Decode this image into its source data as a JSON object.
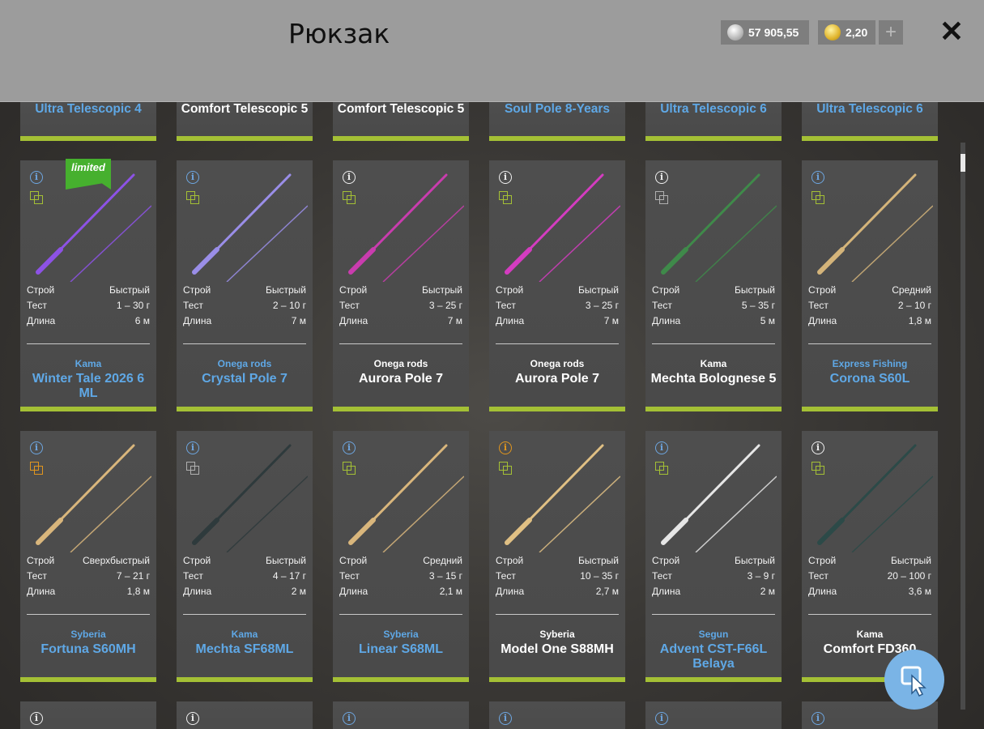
{
  "header": {
    "title": "Рюкзак",
    "silver_amount": "57 905,55",
    "gold_amount": "2,20",
    "plus_label": "+",
    "close_label": "✕"
  },
  "top_row": [
    {
      "name": "Ultra Telescopic 4",
      "color": "blue"
    },
    {
      "name": "Comfort Telescopic 5",
      "color": "white"
    },
    {
      "name": "Comfort Telescopic 5",
      "color": "white"
    },
    {
      "name": "Soul Pole 8-Years",
      "color": "blue"
    },
    {
      "name": "Ultra Telescopic 6",
      "color": "blue"
    },
    {
      "name": "Ultra Telescopic 6",
      "color": "blue"
    }
  ],
  "labels": {
    "action": "Строй",
    "test": "Тест",
    "length": "Длина"
  },
  "badge": {
    "limited": "limited"
  },
  "row1": [
    {
      "action": "Быстрый",
      "test": "1 – 30 г",
      "length": "6 м",
      "brand": "Kama",
      "model": "Winter Tale 2026 6 ML",
      "color": "blue",
      "info": "blue",
      "copy": "green",
      "limited": true,
      "rod_color": "#8d52e6"
    },
    {
      "action": "Быстрый",
      "test": "2 – 10 г",
      "length": "7 м",
      "brand": "Onega rods",
      "model": "Crystal Pole 7",
      "color": "blue",
      "info": "blue",
      "copy": "green",
      "limited": false,
      "rod_color": "#9a8ee8"
    },
    {
      "action": "Быстрый",
      "test": "3 – 25 г",
      "length": "7 м",
      "brand": "Onega rods",
      "model": "Aurora Pole 7",
      "color": "white",
      "info": "white",
      "copy": "green",
      "limited": false,
      "rod_color": "#c93cae"
    },
    {
      "action": "Быстрый",
      "test": "3 – 25 г",
      "length": "7 м",
      "brand": "Onega rods",
      "model": "Aurora Pole 7",
      "color": "white",
      "info": "white",
      "copy": "green",
      "limited": false,
      "rod_color": "#d43cc0"
    },
    {
      "action": "Быстрый",
      "test": "5 – 35 г",
      "length": "5 м",
      "brand": "Kama",
      "model": "Mechta Bolognese 5",
      "color": "white",
      "info": "white",
      "copy": "grey",
      "limited": false,
      "rod_color": "#3f8a4a"
    },
    {
      "action": "Средний",
      "test": "2 – 10 г",
      "length": "1,8 м",
      "brand": "Express Fishing",
      "model": "Corona S60L",
      "color": "blue",
      "info": "blue",
      "copy": "green",
      "limited": false,
      "rod_color": "#d4b47a"
    }
  ],
  "row2": [
    {
      "action": "Сверхбыстрый",
      "test": "7 – 21 г",
      "length": "1,8 м",
      "brand": "Syberia",
      "model": "Fortuna S60MH",
      "color": "blue",
      "info": "blue",
      "copy": "orange",
      "limited": false,
      "rod_color": "#d9b67c"
    },
    {
      "action": "Быстрый",
      "test": "4 – 17 г",
      "length": "2 м",
      "brand": "Kama",
      "model": "Mechta SF68ML",
      "color": "blue",
      "info": "blue",
      "copy": "grey",
      "limited": false,
      "rod_color": "#2e3a3c"
    },
    {
      "action": "Средний",
      "test": "3 – 15 г",
      "length": "2,1 м",
      "brand": "Syberia",
      "model": "Linear S68ML",
      "color": "blue",
      "info": "blue",
      "copy": "green",
      "limited": false,
      "rod_color": "#d9b67c"
    },
    {
      "action": "Быстрый",
      "test": "10 – 35 г",
      "length": "2,7 м",
      "brand": "Syberia",
      "model": "Model One S88MH",
      "color": "white",
      "info": "orange",
      "copy": "green",
      "limited": false,
      "rod_color": "#e0c084"
    },
    {
      "action": "Быстрый",
      "test": "3 – 9 г",
      "length": "2 м",
      "brand": "Segun",
      "model": "Advent CST-F66L Belaya",
      "color": "blue",
      "info": "blue",
      "copy": "green",
      "limited": false,
      "rod_color": "#e6e6e6"
    },
    {
      "action": "Быстрый",
      "test": "20 – 100 г",
      "length": "3,6 м",
      "brand": "Kama",
      "model": "Comfort FD360",
      "color": "white",
      "info": "white",
      "copy": "green",
      "limited": false,
      "rod_color": "#2c4a48"
    }
  ],
  "row3_info": [
    "white",
    "white",
    "blue",
    "blue",
    "blue",
    "blue"
  ]
}
